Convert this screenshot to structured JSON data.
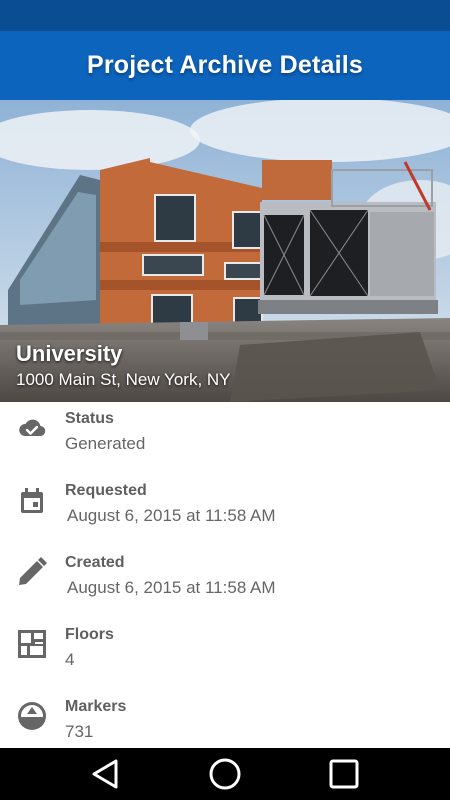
{
  "app_bar": {
    "title": "Project Archive Details"
  },
  "hero": {
    "name": "University",
    "address": "1000 Main St, New York, NY"
  },
  "details": [
    {
      "icon": "cloud-check-icon",
      "label": "Status",
      "value": "Generated"
    },
    {
      "icon": "calendar-icon",
      "label": "Requested",
      "value": "August 6, 2015 at 11:58 AM"
    },
    {
      "icon": "pencil-icon",
      "label": "Created",
      "value": "August 6, 2015 at 11:58 AM"
    },
    {
      "icon": "floor-plan-icon",
      "label": "Floors",
      "value": "4"
    },
    {
      "icon": "marker-icon",
      "label": "Markers",
      "value": "731"
    }
  ],
  "nav": {
    "back": "back-icon",
    "home": "home-icon",
    "recents": "recents-icon"
  },
  "colors": {
    "status_bar": "#0b4d92",
    "app_bar": "#0d64bd",
    "icon_gray": "#666666"
  }
}
